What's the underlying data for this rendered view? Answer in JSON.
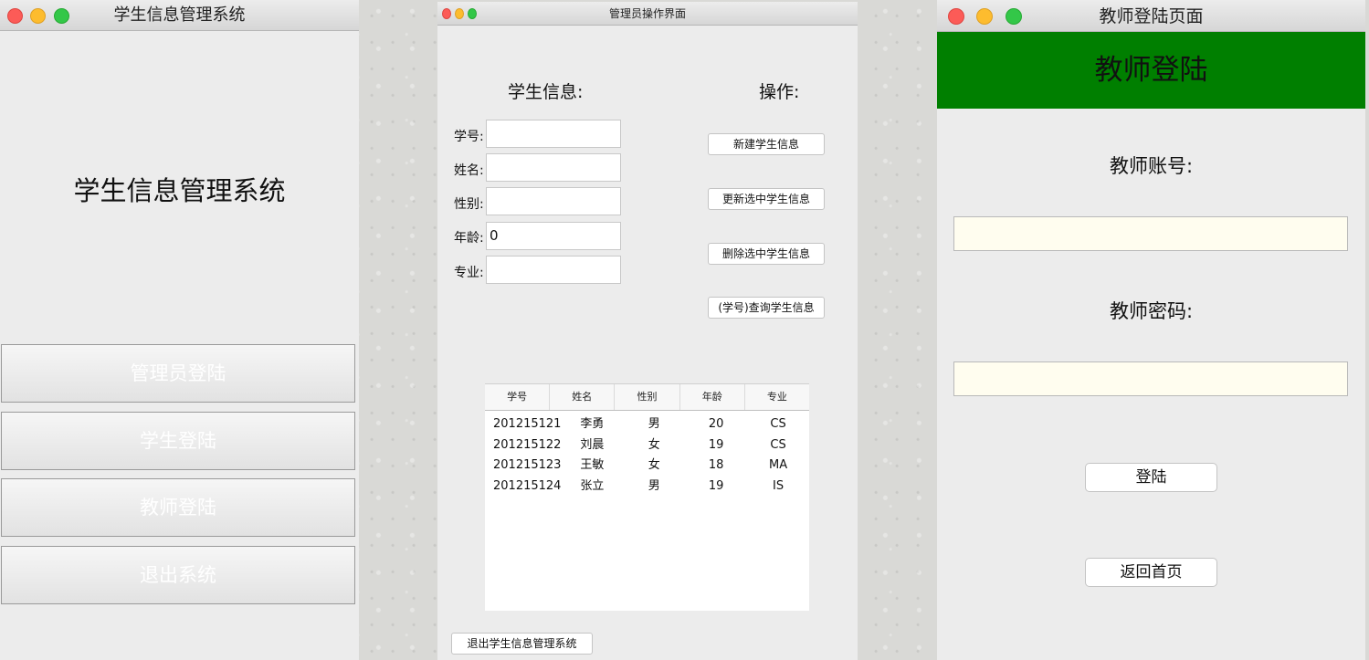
{
  "main_window": {
    "title": "学生信息管理系统",
    "heading": "学生信息管理系统",
    "buttons": [
      "管理员登陆",
      "学生登陆",
      "教师登陆",
      "退出系统"
    ]
  },
  "admin_window": {
    "title": "管理员操作界面",
    "student_info_heading": "学生信息:",
    "operations_heading": "操作:",
    "fields": [
      {
        "label": "学号:",
        "value": ""
      },
      {
        "label": "姓名:",
        "value": ""
      },
      {
        "label": "性别:",
        "value": ""
      },
      {
        "label": "年龄:",
        "value": "0"
      },
      {
        "label": "专业:",
        "value": ""
      }
    ],
    "operation_buttons": [
      "新建学生信息",
      "更新选中学生信息",
      "删除选中学生信息",
      "(学号)查询学生信息"
    ],
    "table": {
      "columns": [
        "学号",
        "姓名",
        "性别",
        "年龄",
        "专业"
      ],
      "rows": [
        [
          "201215121",
          "李勇",
          "男",
          "20",
          "CS"
        ],
        [
          "201215122",
          "刘晨",
          "女",
          "19",
          "CS"
        ],
        [
          "201215123",
          "王敏",
          "女",
          "18",
          "MA"
        ],
        [
          "201215124",
          "张立",
          "男",
          "19",
          "IS"
        ]
      ]
    },
    "exit_button": "退出学生信息管理系统"
  },
  "teacher_window": {
    "title": "教师登陆页面",
    "banner": "教师登陆",
    "account_label": "教师账号:",
    "password_label": "教师密码:",
    "login_button": "登陆",
    "back_button": "返回首页",
    "banner_color": "#007f00"
  }
}
